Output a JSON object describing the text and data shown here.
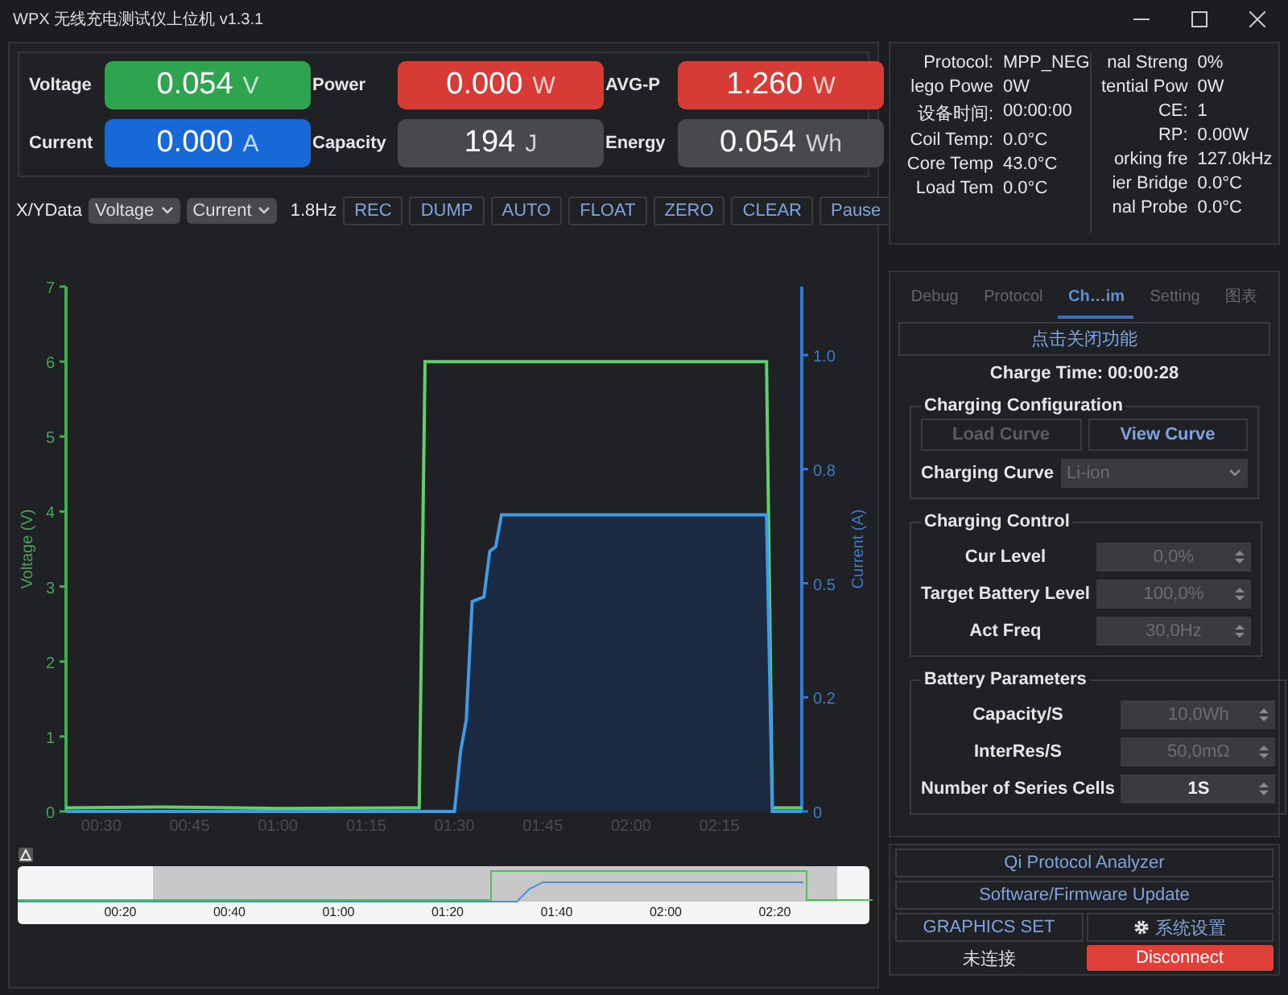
{
  "window": {
    "title": "WPX 无线充电测试仪上位机 v1.3.1"
  },
  "metrics": [
    {
      "label": "Voltage",
      "value": "0.054",
      "unit": "V",
      "color": "#2ea44f"
    },
    {
      "label": "Power",
      "value": "0.000",
      "unit": "W",
      "color": "#d63b35"
    },
    {
      "label": "AVG-P",
      "value": "1.260",
      "unit": "W",
      "color": "#d63b35"
    },
    {
      "label": "Current",
      "value": "0.000",
      "unit": "A",
      "color": "#1669d6"
    },
    {
      "label": "Capacity",
      "value": "194",
      "unit": "J",
      "color": "#48494d"
    },
    {
      "label": "Energy",
      "value": "0.054",
      "unit": "Wh",
      "color": "#48494d"
    }
  ],
  "toolbar": {
    "label": "X/YData",
    "x_select": "Voltage",
    "y_select": "Current",
    "rate": "1.8Hz",
    "buttons": [
      "REC",
      "DUMP",
      "AUTO",
      "FLOAT",
      "ZERO",
      "CLEAR",
      "Pause"
    ]
  },
  "chart_data": {
    "type": "line",
    "ylabel": "Voltage (V)",
    "y2label": "Current (A)",
    "x": [
      24,
      40,
      60,
      84,
      85,
      90,
      91,
      92,
      93,
      95,
      96,
      97,
      98,
      143,
      144,
      149
    ],
    "series": [
      {
        "color": "#5fd06a",
        "values": [
          0.05,
          0.06,
          0.04,
          0.05,
          6.0,
          6.0,
          6.0,
          6.0,
          6.0,
          6.0,
          6.0,
          6.0,
          6.0,
          6.0,
          0.05,
          0.05
        ]
      },
      {
        "color": "#3d9be9",
        "axis": "y2",
        "values": [
          0,
          0,
          0,
          0,
          0,
          0,
          0.13,
          0.2,
          0.46,
          0.47,
          0.57,
          0.58,
          0.65,
          0.65,
          0,
          0
        ]
      }
    ],
    "xlim": [
      24,
      149
    ],
    "ylim": [
      0,
      7
    ],
    "y2lim": [
      0,
      1.15
    ],
    "xticks": [
      {
        "value": 30,
        "label": "00:30"
      },
      {
        "value": 45,
        "label": "00:45"
      },
      {
        "value": 60,
        "label": "01:00"
      },
      {
        "value": 75,
        "label": "01:15"
      },
      {
        "value": 90,
        "label": "01:30"
      },
      {
        "value": 105,
        "label": "01:45"
      },
      {
        "value": 120,
        "label": "02:00"
      },
      {
        "value": 135,
        "label": "02:15"
      }
    ],
    "yticks": [
      0,
      1,
      2,
      3,
      4,
      5,
      6,
      7
    ],
    "y2ticks": [
      {
        "value": 0,
        "label": "0"
      },
      {
        "value": 0.25,
        "label": "0.2"
      },
      {
        "value": 0.5,
        "label": "0.5"
      },
      {
        "value": 0.75,
        "label": "0.8"
      },
      {
        "value": 1.0,
        "label": "1.0"
      }
    ]
  },
  "overview": {
    "ticks": [
      "00:20",
      "00:40",
      "01:00",
      "01:20",
      "01:40",
      "02:00",
      "02:20"
    ]
  },
  "info": {
    "left": [
      {
        "label": "Protocol:",
        "value": "MPP_NEG"
      },
      {
        "label": "lego Powe",
        "value": "0W"
      },
      {
        "label": "设备时间:",
        "value": "00:00:00"
      },
      {
        "label": "Coil Temp:",
        "value": "0.0°C"
      },
      {
        "label": "Core Temp",
        "value": "43.0°C"
      },
      {
        "label": "Load Tem",
        "value": "0.0°C"
      }
    ],
    "right": [
      {
        "label": "nal Streng",
        "value": "0%"
      },
      {
        "label": "tential Pow",
        "value": "0W"
      },
      {
        "label": "CE:",
        "value": "1"
      },
      {
        "label": "RP:",
        "value": "0.00W"
      },
      {
        "label": "orking fre",
        "value": "127.0kHz"
      },
      {
        "label": "ier Bridge",
        "value": "0.0°C"
      },
      {
        "label": "nal Probe",
        "value": "0.0°C"
      }
    ]
  },
  "tabs": [
    {
      "label": "Debug",
      "selected": false
    },
    {
      "label": "Protocol",
      "selected": false
    },
    {
      "label": "Ch…im",
      "selected": true
    },
    {
      "label": "Setting",
      "selected": false
    },
    {
      "label": "图表",
      "selected": false
    }
  ],
  "function_button": "点击关闭功能",
  "charge_time": "Charge Time: 00:00:28",
  "charging_configuration": {
    "title": "Charging Configuration",
    "buttons": [
      {
        "label": "Load Curve",
        "disabled": true
      },
      {
        "label": "View Curve",
        "disabled": false
      }
    ],
    "curve_label": "Charging Curve",
    "curve_value": "Li-ion",
    "curve_disabled": true
  },
  "charging_control": {
    "title": "Charging Control",
    "fields": [
      {
        "label": "Cur Level",
        "value": "0,0%",
        "disabled": true
      },
      {
        "label": "Target Battery Level",
        "value": "100,0%",
        "disabled": true
      },
      {
        "label": "Act Freq",
        "value": "30,0Hz",
        "disabled": true
      }
    ]
  },
  "battery_parameters": {
    "title": "Battery Parameters",
    "fields": [
      {
        "label": "Capacity/S",
        "value": "10,0Wh",
        "disabled": true
      },
      {
        "label": "InterRes/S",
        "value": "50,0mΩ",
        "disabled": true
      },
      {
        "label": "Number of Series Cells",
        "value": "1S",
        "disabled": false
      }
    ]
  },
  "bottom_buttons": [
    "Qi Protocol Analyzer",
    "Software/Firmware Update",
    "GRAPHICS SET",
    "系统设置"
  ],
  "status": {
    "text": "未连接",
    "button": "Disconnect"
  }
}
